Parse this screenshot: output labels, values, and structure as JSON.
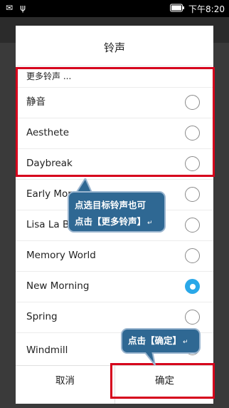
{
  "statusbar": {
    "time": "下午8:20",
    "battery_icon": "battery-icon",
    "usb_icon": "usb-icon",
    "notification_icon": "notification-icon"
  },
  "dialog": {
    "title": "铃声",
    "more_label": "更多铃声 ...",
    "items": [
      {
        "label": "静音",
        "checked": false
      },
      {
        "label": "Aesthete",
        "checked": false
      },
      {
        "label": "Daybreak",
        "checked": false
      },
      {
        "label": "Early Morning",
        "checked": false
      },
      {
        "label": "Lisa La Bossa",
        "checked": false
      },
      {
        "label": "Memory World",
        "checked": false
      },
      {
        "label": "New Morning",
        "checked": true
      },
      {
        "label": "Spring",
        "checked": false
      },
      {
        "label": "Windmill",
        "checked": false
      }
    ],
    "cancel_label": "取消",
    "ok_label": "确定"
  },
  "callouts": {
    "select_hint_line1": "点选目标铃声也可",
    "select_hint_line2": "点击【更多铃声】",
    "ok_hint": "点击【确定】"
  },
  "colors": {
    "accent": "#2aa8e8",
    "highlight": "#d6001c",
    "callout_bg": "#2f6893"
  }
}
